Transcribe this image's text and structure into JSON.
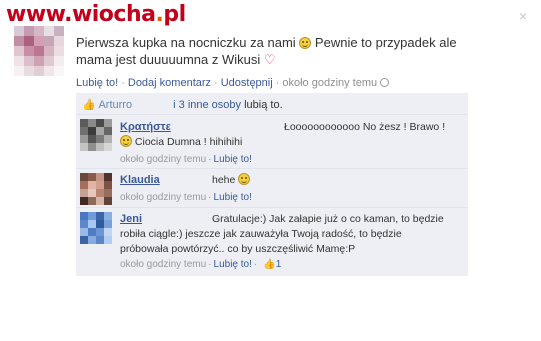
{
  "watermark": {
    "prefix": "www.",
    "name": "wiocha",
    "tld": "pl",
    "dot": "."
  },
  "close_icon": "×",
  "post": {
    "text_1": "Pierwsza kupka na nocniczku za nami",
    "text_2": "Pewnie to przypadek ale mama jest duuuuumna z Wikusi",
    "emoticon": "smile-emoticon",
    "heart": "♡",
    "actions": {
      "like": "Lubię to!",
      "comment": "Dodaj komentarz",
      "share": "Udostępnij",
      "time": "około godziny temu",
      "separator": "·"
    }
  },
  "likes": {
    "thumb": "👍",
    "name": "Arturro",
    "others_link": "i 3 inne osoby",
    "suffix": "lubią to."
  },
  "comments": [
    {
      "name": "Κρατήστε",
      "text_right": "Łoooooooooooo No żesz ! Brawo !",
      "text_line2": "Ciocia Dumna ! hihihihi",
      "time": "około godziny temu",
      "like": "Lubię to!",
      "separator": "·"
    },
    {
      "name": "Klaudia",
      "text": "hehe",
      "time": "około godziny temu",
      "like": "Lubię to!",
      "separator": "·"
    },
    {
      "name": "Jeni",
      "text_1": "Gratulacje:) Jak załapie już o co kaman, to będzie",
      "text_2": "robiła ciągle:) jeszcze jak zauważyła Twoją radość, to będzie",
      "text_3": "próbowała powtórzyć.. co by uszczęśliwić Mamę:P",
      "time": "około godziny temu",
      "like": "Lubię to!",
      "like_count": "1",
      "separator": "·"
    }
  ],
  "colors": {
    "link": "#3b5998",
    "thread_bg": "#edeff4",
    "watermark": "#c2001b"
  }
}
